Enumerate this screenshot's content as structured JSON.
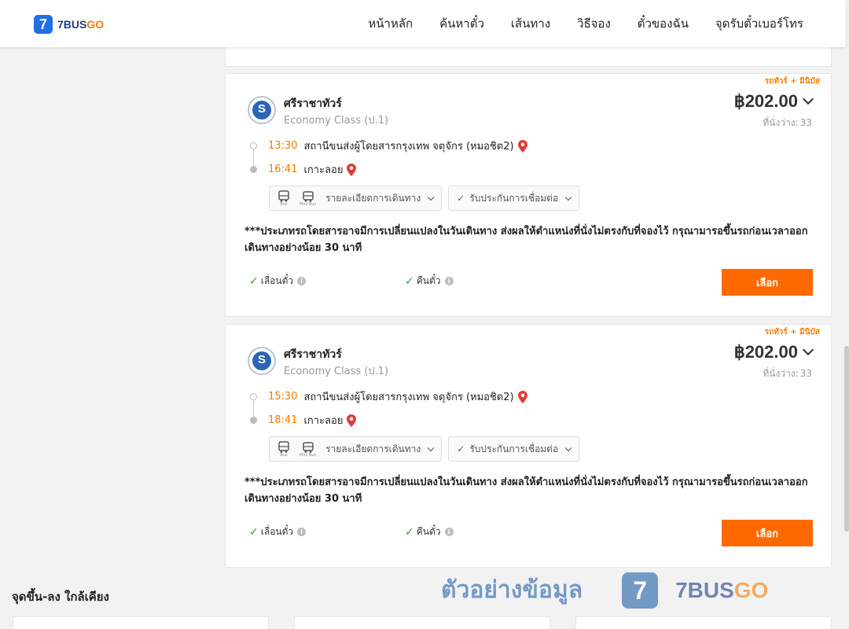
{
  "brand": {
    "logo_mark": "7",
    "name_part1": "7BUS",
    "name_part2": "GO"
  },
  "nav": [
    "หน้าหลัก",
    "ค้นหาตั๋ว",
    "เส้นทาง",
    "วิธีจอง",
    "ตั๋วของฉัน",
    "จุดรับตั๋วเบอร์โทร"
  ],
  "trips": [
    {
      "tag": "รถทัวร์ + มินิบัส",
      "operator": "ศรีราชาทัวร์",
      "class": "Economy Class (ป.1)",
      "price": "฿202.00",
      "seats_label": "ที่นั่งว่าง:",
      "seats": "33",
      "depart_time": "13:30",
      "depart_place": "สถานีขนส่งผู้โดยสารกรุงเทพ จตุจักร (หมอชิต2)",
      "arrive_time": "16:41",
      "arrive_place": "เกาะลอย",
      "bus_label": "Bus",
      "minibus_label": "Mini Bus",
      "details_label": "รายละเอียดการเดินทาง",
      "connection_label": "รับประกันการเชื่อมต่อ",
      "notice": "***ประเภทรถโดยสารอาจมีการเปลี่ยนแปลงในวันเดินทาง ส่งผลให้ตำแหน่งที่นั่งไม่ตรงกับที่จองไว้ กรุณามารอขึ้นรถก่อนเวลาออกเดินทางอย่างน้อย 30 นาที",
      "feature_reschedule": "เลื่อนตั๋ว",
      "feature_refund": "คืนตั๋ว",
      "select_label": "เลือก"
    },
    {
      "tag": "รถทัวร์ + มินิบัส",
      "operator": "ศรีราชาทัวร์",
      "class": "Economy Class (ป.1)",
      "price": "฿202.00",
      "seats_label": "ที่นั่งว่าง:",
      "seats": "33",
      "depart_time": "15:30",
      "depart_place": "สถานีขนส่งผู้โดยสารกรุงเทพ จตุจักร (หมอชิต2)",
      "arrive_time": "18:41",
      "arrive_place": "เกาะลอย",
      "bus_label": "Bus",
      "minibus_label": "Mini Bus",
      "details_label": "รายละเอียดการเดินทาง",
      "connection_label": "รับประกันการเชื่อมต่อ",
      "notice": "***ประเภทรถโดยสารอาจมีการเปลี่ยนแปลงในวันเดินทาง ส่งผลให้ตำแหน่งที่นั่งไม่ตรงกับที่จองไว้ กรุณามารอขึ้นรถก่อนเวลาออกเดินทางอย่างน้อย 30 นาที",
      "feature_reschedule": "เลื่อนตั๋ว",
      "feature_refund": "คืนตั๋ว",
      "select_label": "เลือก"
    }
  ],
  "nearby_title": "จุดขึ้น-ลง ใกล้เคียง",
  "watermark": {
    "text": "ตัวอย่างข้อมูล",
    "logo_mark": "7",
    "brand_part1": "7BUS",
    "brand_part2": "GO"
  },
  "colors": {
    "accent": "#ff6a00",
    "time": "#f57c00",
    "brand_blue": "#1f6fe6",
    "tick": "#2e9e3e",
    "pin": "#e53935"
  },
  "icons": [
    "pin-icon",
    "bus-icon",
    "minibus-icon",
    "chevron-down-icon",
    "check-icon",
    "info-icon"
  ]
}
